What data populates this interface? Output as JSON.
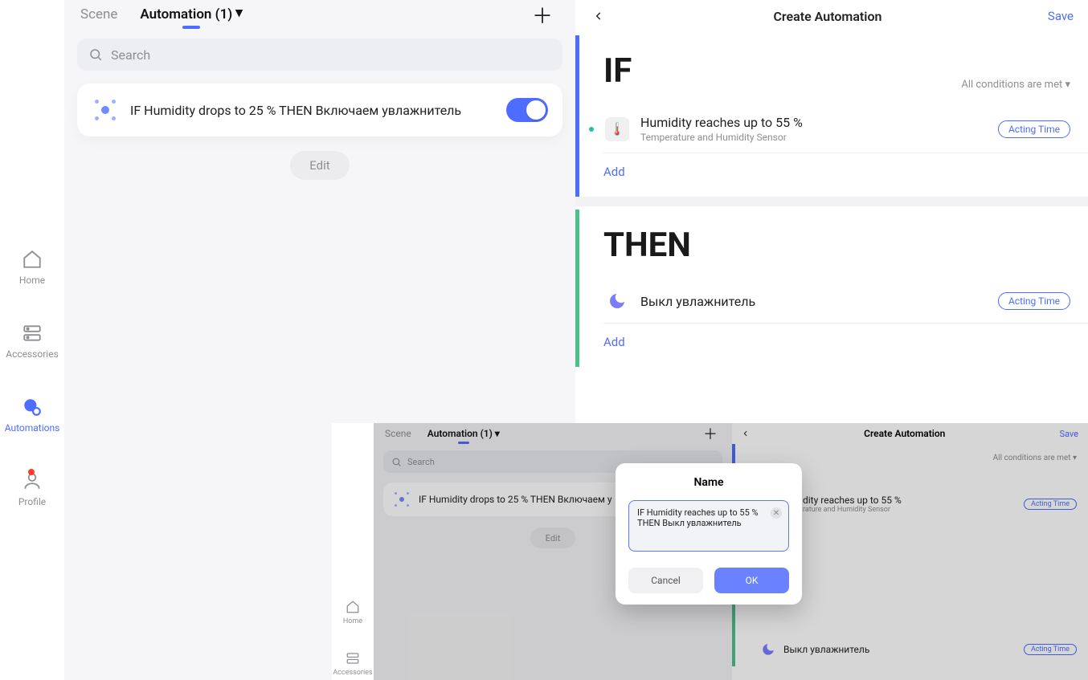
{
  "sidebar": {
    "items": [
      {
        "label": "Home"
      },
      {
        "label": "Accessories"
      },
      {
        "label": "Automations"
      },
      {
        "label": "Profile"
      }
    ]
  },
  "tabs": {
    "scene": "Scene",
    "automation": "Automation (1)"
  },
  "search": {
    "placeholder": "Search"
  },
  "automation_card": {
    "text": "IF Humidity drops to  25 % THEN Включаем увлажнитель"
  },
  "edit_label": "Edit",
  "detail": {
    "title": "Create Automation",
    "save": "Save",
    "if_label": "IF",
    "then_label": "THEN",
    "conditions_mode": "All conditions are met",
    "if_item": {
      "line1": "Humidity reaches up to 55 %",
      "line2": "Temperature and Humidity Sensor"
    },
    "then_item": {
      "line1": "Выкл увлажнитель"
    },
    "acting_time": "Acting Time",
    "add": "Add"
  },
  "mini": {
    "sidebar": {
      "home": "Home",
      "accessories": "Accessories"
    },
    "tabs": {
      "scene": "Scene",
      "automation": "Automation (1)"
    },
    "search_placeholder": "Search",
    "card_text": "IF Humidity drops to  25 % THEN Включаем у",
    "edit": "Edit",
    "detail_title": "Create Automation",
    "save": "Save",
    "conditions_mode": "All conditions are met",
    "if_line1": "dity reaches up to 55 %",
    "if_line2": "rature and Humidity Sensor",
    "then_line1": "Выкл увлажнитель",
    "acting_time": "Acting Time",
    "dialog": {
      "title": "Name",
      "value": "IF Humidity reaches up to 55 % THEN Выкл увлажнитель",
      "cancel": "Cancel",
      "ok": "OK"
    }
  }
}
